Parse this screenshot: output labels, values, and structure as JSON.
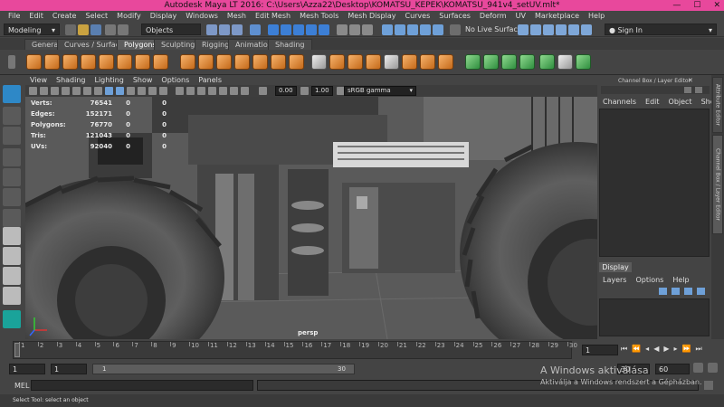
{
  "window": {
    "title": "Autodesk Maya LT 2016: C:\\Users\\Azza22\\Desktop\\KOMATSU_KEPEK\\KOMATSU_941v4_setUV.mlt*"
  },
  "menubar": [
    "File",
    "Edit",
    "Create",
    "Select",
    "Modify",
    "Display",
    "Windows",
    "Mesh",
    "Edit Mesh",
    "Mesh Tools",
    "Mesh Display",
    "Curves",
    "Surfaces",
    "Deform",
    "UV",
    "Marketplace",
    "Help"
  ],
  "statusline": {
    "mode": "Modeling",
    "selection_mask": "Objects",
    "live_surface": "No Live Surface",
    "sign_in": "Sign In"
  },
  "shelf_tabs": [
    "General",
    "Curves / Surfaces",
    "Polygons",
    "Sculpting",
    "Rigging",
    "Animation",
    "Shading"
  ],
  "shelf_active_tab": "Polygons",
  "viewport": {
    "menu": [
      "View",
      "Shading",
      "Lighting",
      "Show",
      "Options",
      "Panels"
    ],
    "exposure": "0.00",
    "gamma": "1.00",
    "color_space": "sRGB gamma",
    "camera_label": "persp",
    "hud": [
      {
        "label": "Verts:",
        "v1": "76541",
        "v2": "0",
        "v3": "0"
      },
      {
        "label": "Edges:",
        "v1": "152171",
        "v2": "0",
        "v3": "0"
      },
      {
        "label": "Polygons:",
        "v1": "76770",
        "v2": "0",
        "v3": "0"
      },
      {
        "label": "Tris:",
        "v1": "121043",
        "v2": "0",
        "v3": "0"
      },
      {
        "label": "UVs:",
        "v1": "92040",
        "v2": "0",
        "v3": "0"
      }
    ]
  },
  "channel_box": {
    "title": "Channel Box / Layer Editor",
    "menu": [
      "Channels",
      "Edit",
      "Object",
      "Show"
    ],
    "display_tab": "Display",
    "layers_menu": [
      "Layers",
      "Options",
      "Help"
    ]
  },
  "side_tabs": [
    "Attribute Editor",
    "Channel Box / Layer Editor"
  ],
  "timeline": {
    "ticks": [
      "1",
      "2",
      "3",
      "4",
      "5",
      "6",
      "7",
      "8",
      "9",
      "10",
      "11",
      "12",
      "13",
      "14",
      "15",
      "16",
      "17",
      "18",
      "19",
      "20",
      "21",
      "22",
      "23",
      "24",
      "25",
      "26",
      "27",
      "28",
      "29",
      "30"
    ],
    "current_frame": "1"
  },
  "range": {
    "start_field": "1",
    "start_inner": "1",
    "slider_start": "1",
    "slider_end": "30",
    "end_inner": "30",
    "end_field": "60"
  },
  "cmdline": {
    "label": "MEL"
  },
  "helpline": {
    "text": "Select Tool: select an object"
  },
  "windows_activation": {
    "line1": "A Windows aktiválása",
    "line2": "Aktiválja a Windows rendszert a Gépházban."
  },
  "colors": {
    "titlebar": "#e8489c",
    "shelf_icon": "#e8883a",
    "toolbox_accent": "#2e88c7"
  }
}
